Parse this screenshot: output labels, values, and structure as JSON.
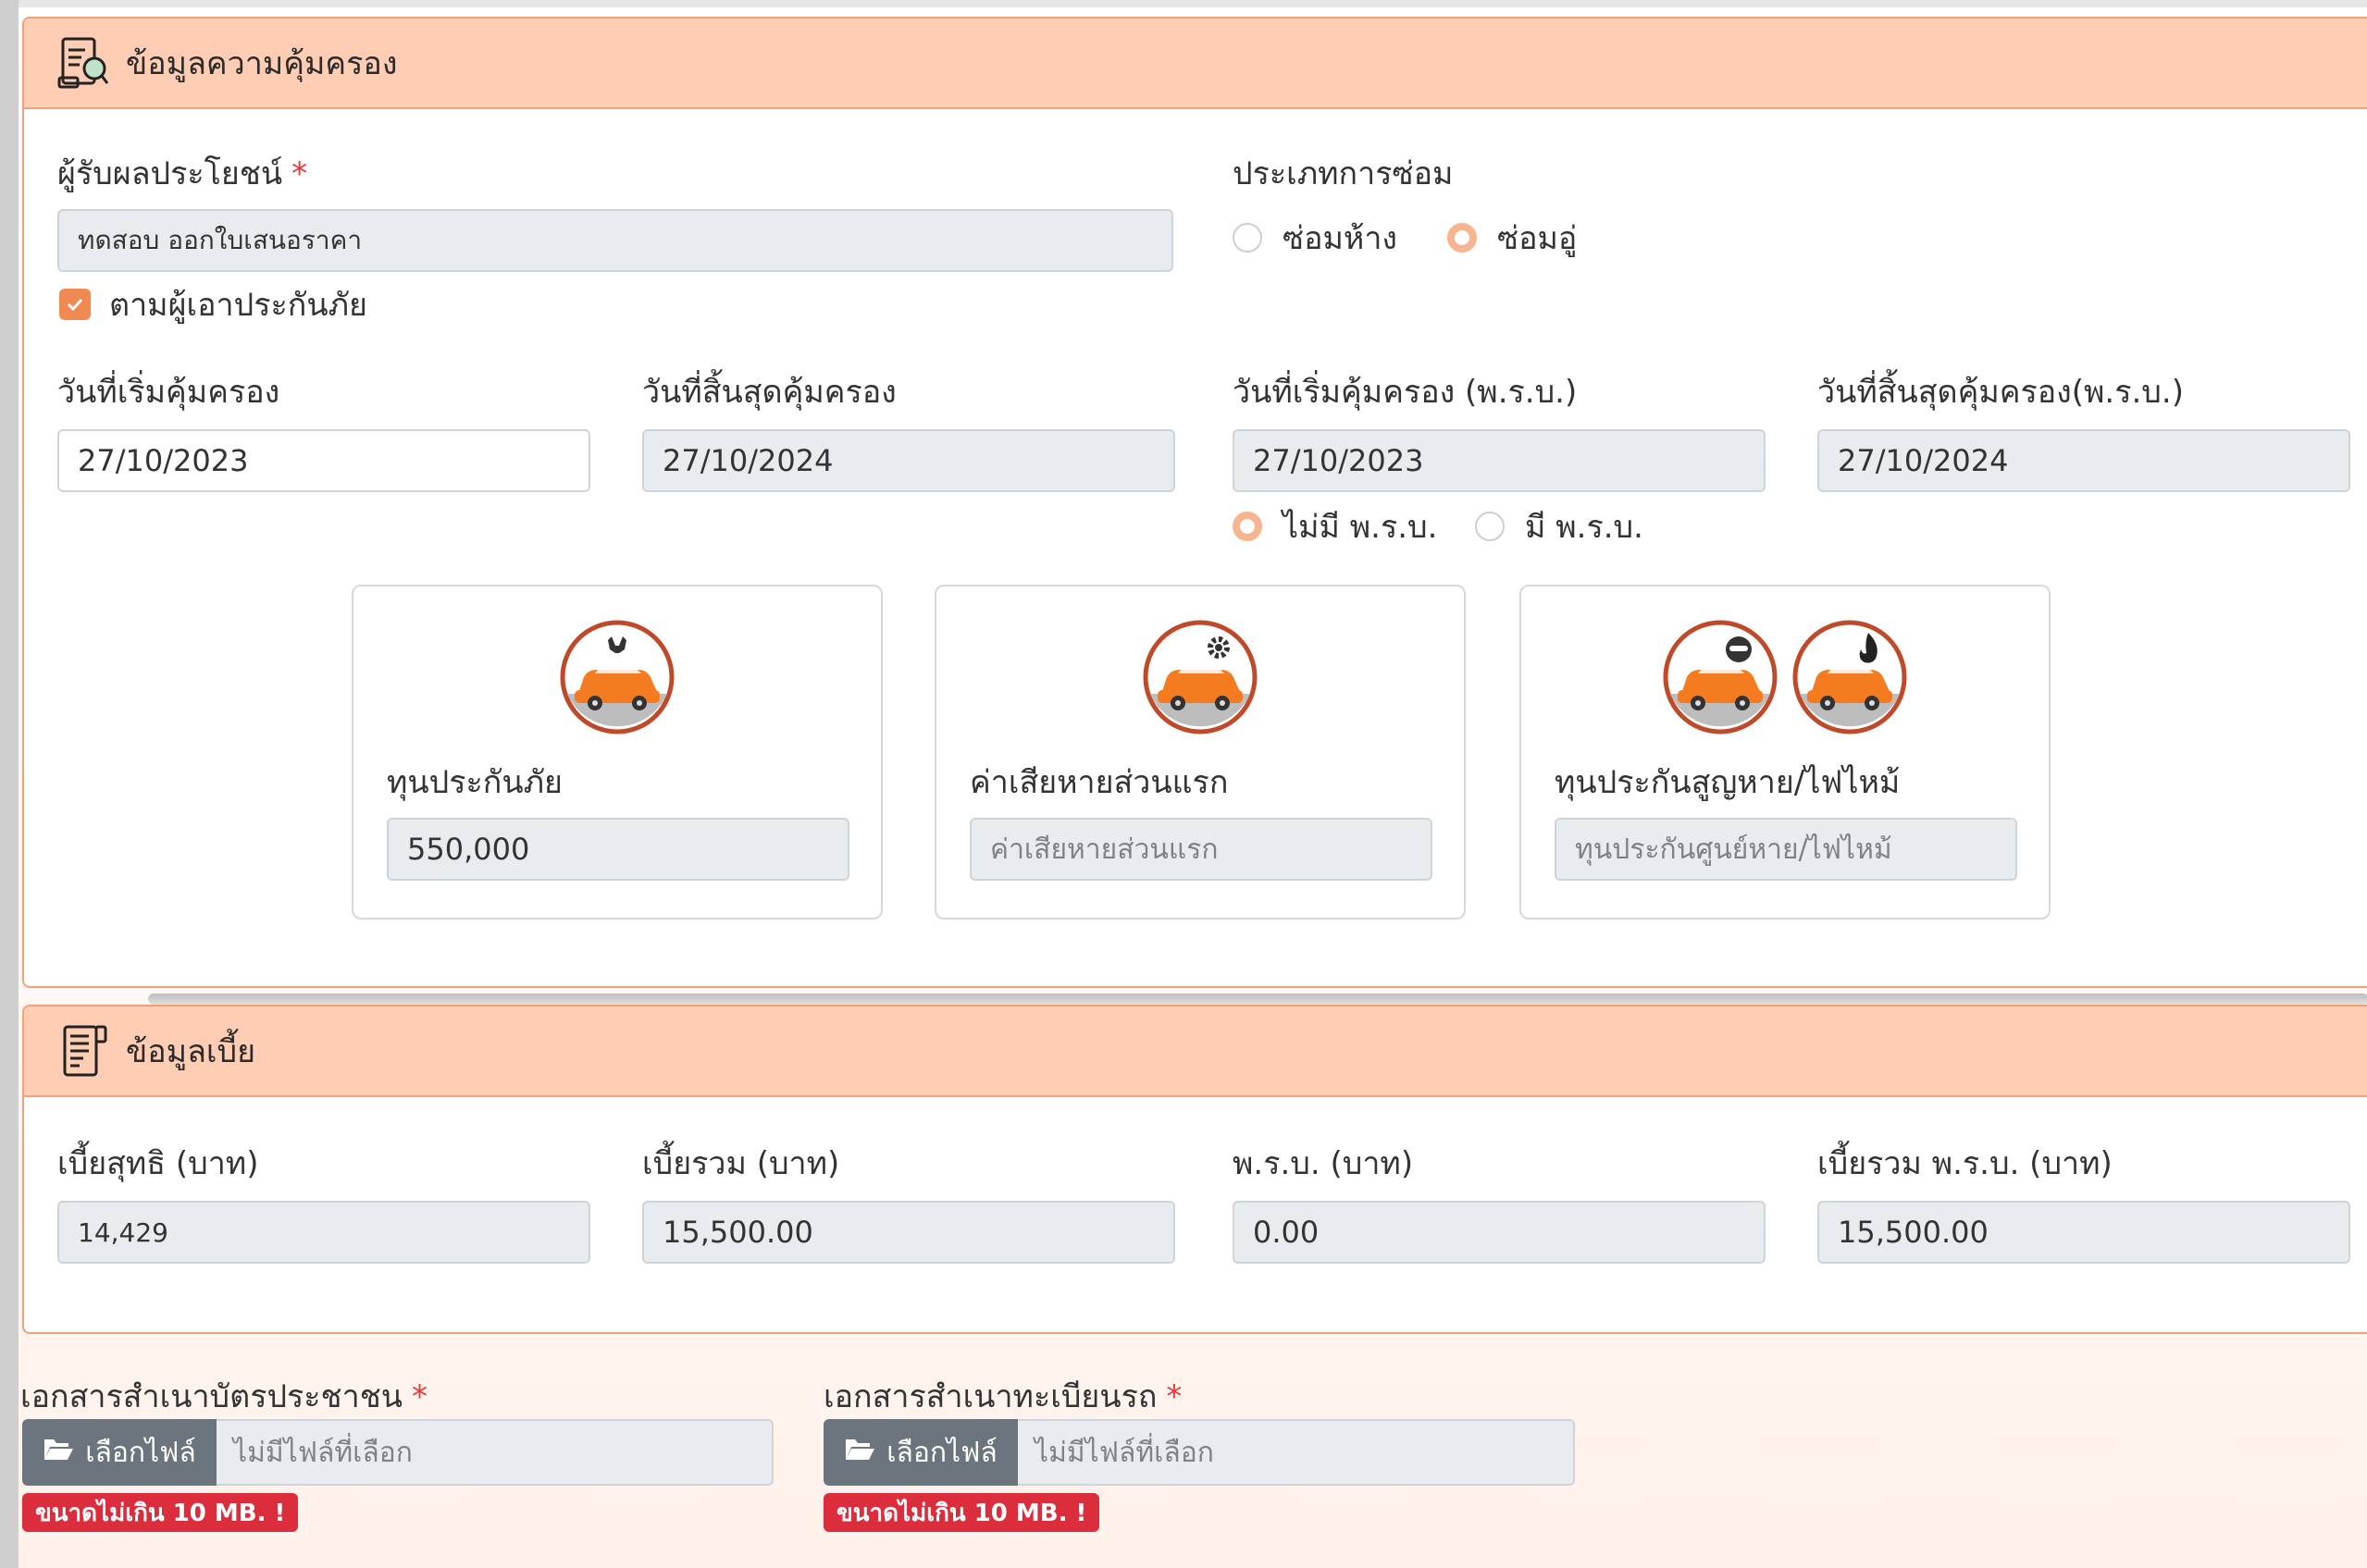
{
  "coverage": {
    "title": "ข้อมูลความคุ้มครอง",
    "beneficiary": {
      "label": "ผู้รับผลประโยชน์",
      "required_mark": "*",
      "value": "ทดสอบ ออกใบเสนอราคา",
      "checkbox_label": "ตามผู้เอาประกันภัย",
      "checked": true
    },
    "repair_type": {
      "label": "ประเภทการซ่อม",
      "options": [
        "ซ่อมห้าง",
        "ซ่อมอู่"
      ],
      "selected": "ซ่อมอู่"
    },
    "start_date": {
      "label": "วันที่เริ่มคุ้มครอง",
      "value": "27/10/2023"
    },
    "end_date": {
      "label": "วันที่สิ้นสุดคุ้มครอง",
      "value": "27/10/2024"
    },
    "cmi_start_date": {
      "label": "วันที่เริ่มคุ้มครอง (พ.ร.บ.)",
      "value": "27/10/2023"
    },
    "cmi_end_date": {
      "label": "วันที่สิ้นสุดคุ้มครอง(พ.ร.บ.)",
      "value": "27/10/2024"
    },
    "cmi_options": {
      "options": [
        "ไม่มี พ.ร.บ.",
        "มี พ.ร.บ."
      ],
      "selected": "ไม่มี พ.ร.บ."
    },
    "sum_insured": {
      "label": "ทุนประกันภัย",
      "value": "550,000"
    },
    "deductible": {
      "label": "ค่าเสียหายส่วนแรก",
      "placeholder": "ค่าเสียหายส่วนแรก"
    },
    "theft_fire": {
      "label": "ทุนประกันสูญหาย/ไฟไหม้",
      "placeholder": "ทุนประกันศูนย์หาย/ไฟไหม้"
    }
  },
  "premium": {
    "title": "ข้อมูลเบี้ย",
    "net_premium": {
      "label": "เบี้ยสุทธิ (บาท)",
      "value": "14,429"
    },
    "total_premium": {
      "label": "เบี้ยรวม (บาท)",
      "value": "15,500.00"
    },
    "cmi_premium": {
      "label": "พ.ร.บ. (บาท)",
      "value": "0.00"
    },
    "total_with_cmi": {
      "label": "เบี้ยรวม พ.ร.บ. (บาท)",
      "value": "15,500.00"
    }
  },
  "documents": {
    "id_card": {
      "label": "เอกสารสำเนาบัตรประชาชน",
      "required_mark": "*",
      "button": "เลือกไฟล์",
      "file_text": "ไม่มีไฟล์ที่เลือก",
      "badge": "ขนาดไม่เกิน 10 MB. !"
    },
    "vehicle_reg": {
      "label": "เอกสารสำเนาทะเบียนรถ",
      "required_mark": "*",
      "button": "เลือกไฟล์",
      "file_text": "ไม่มีไฟล์ที่เลือก",
      "badge": "ขนาดไม่เกิน 10 MB. !"
    }
  },
  "colors": {
    "header_bg": "#ffcdb4",
    "accent": "#f08a52",
    "badge_red": "#dc2d3c",
    "button_gray": "#6c757d"
  }
}
